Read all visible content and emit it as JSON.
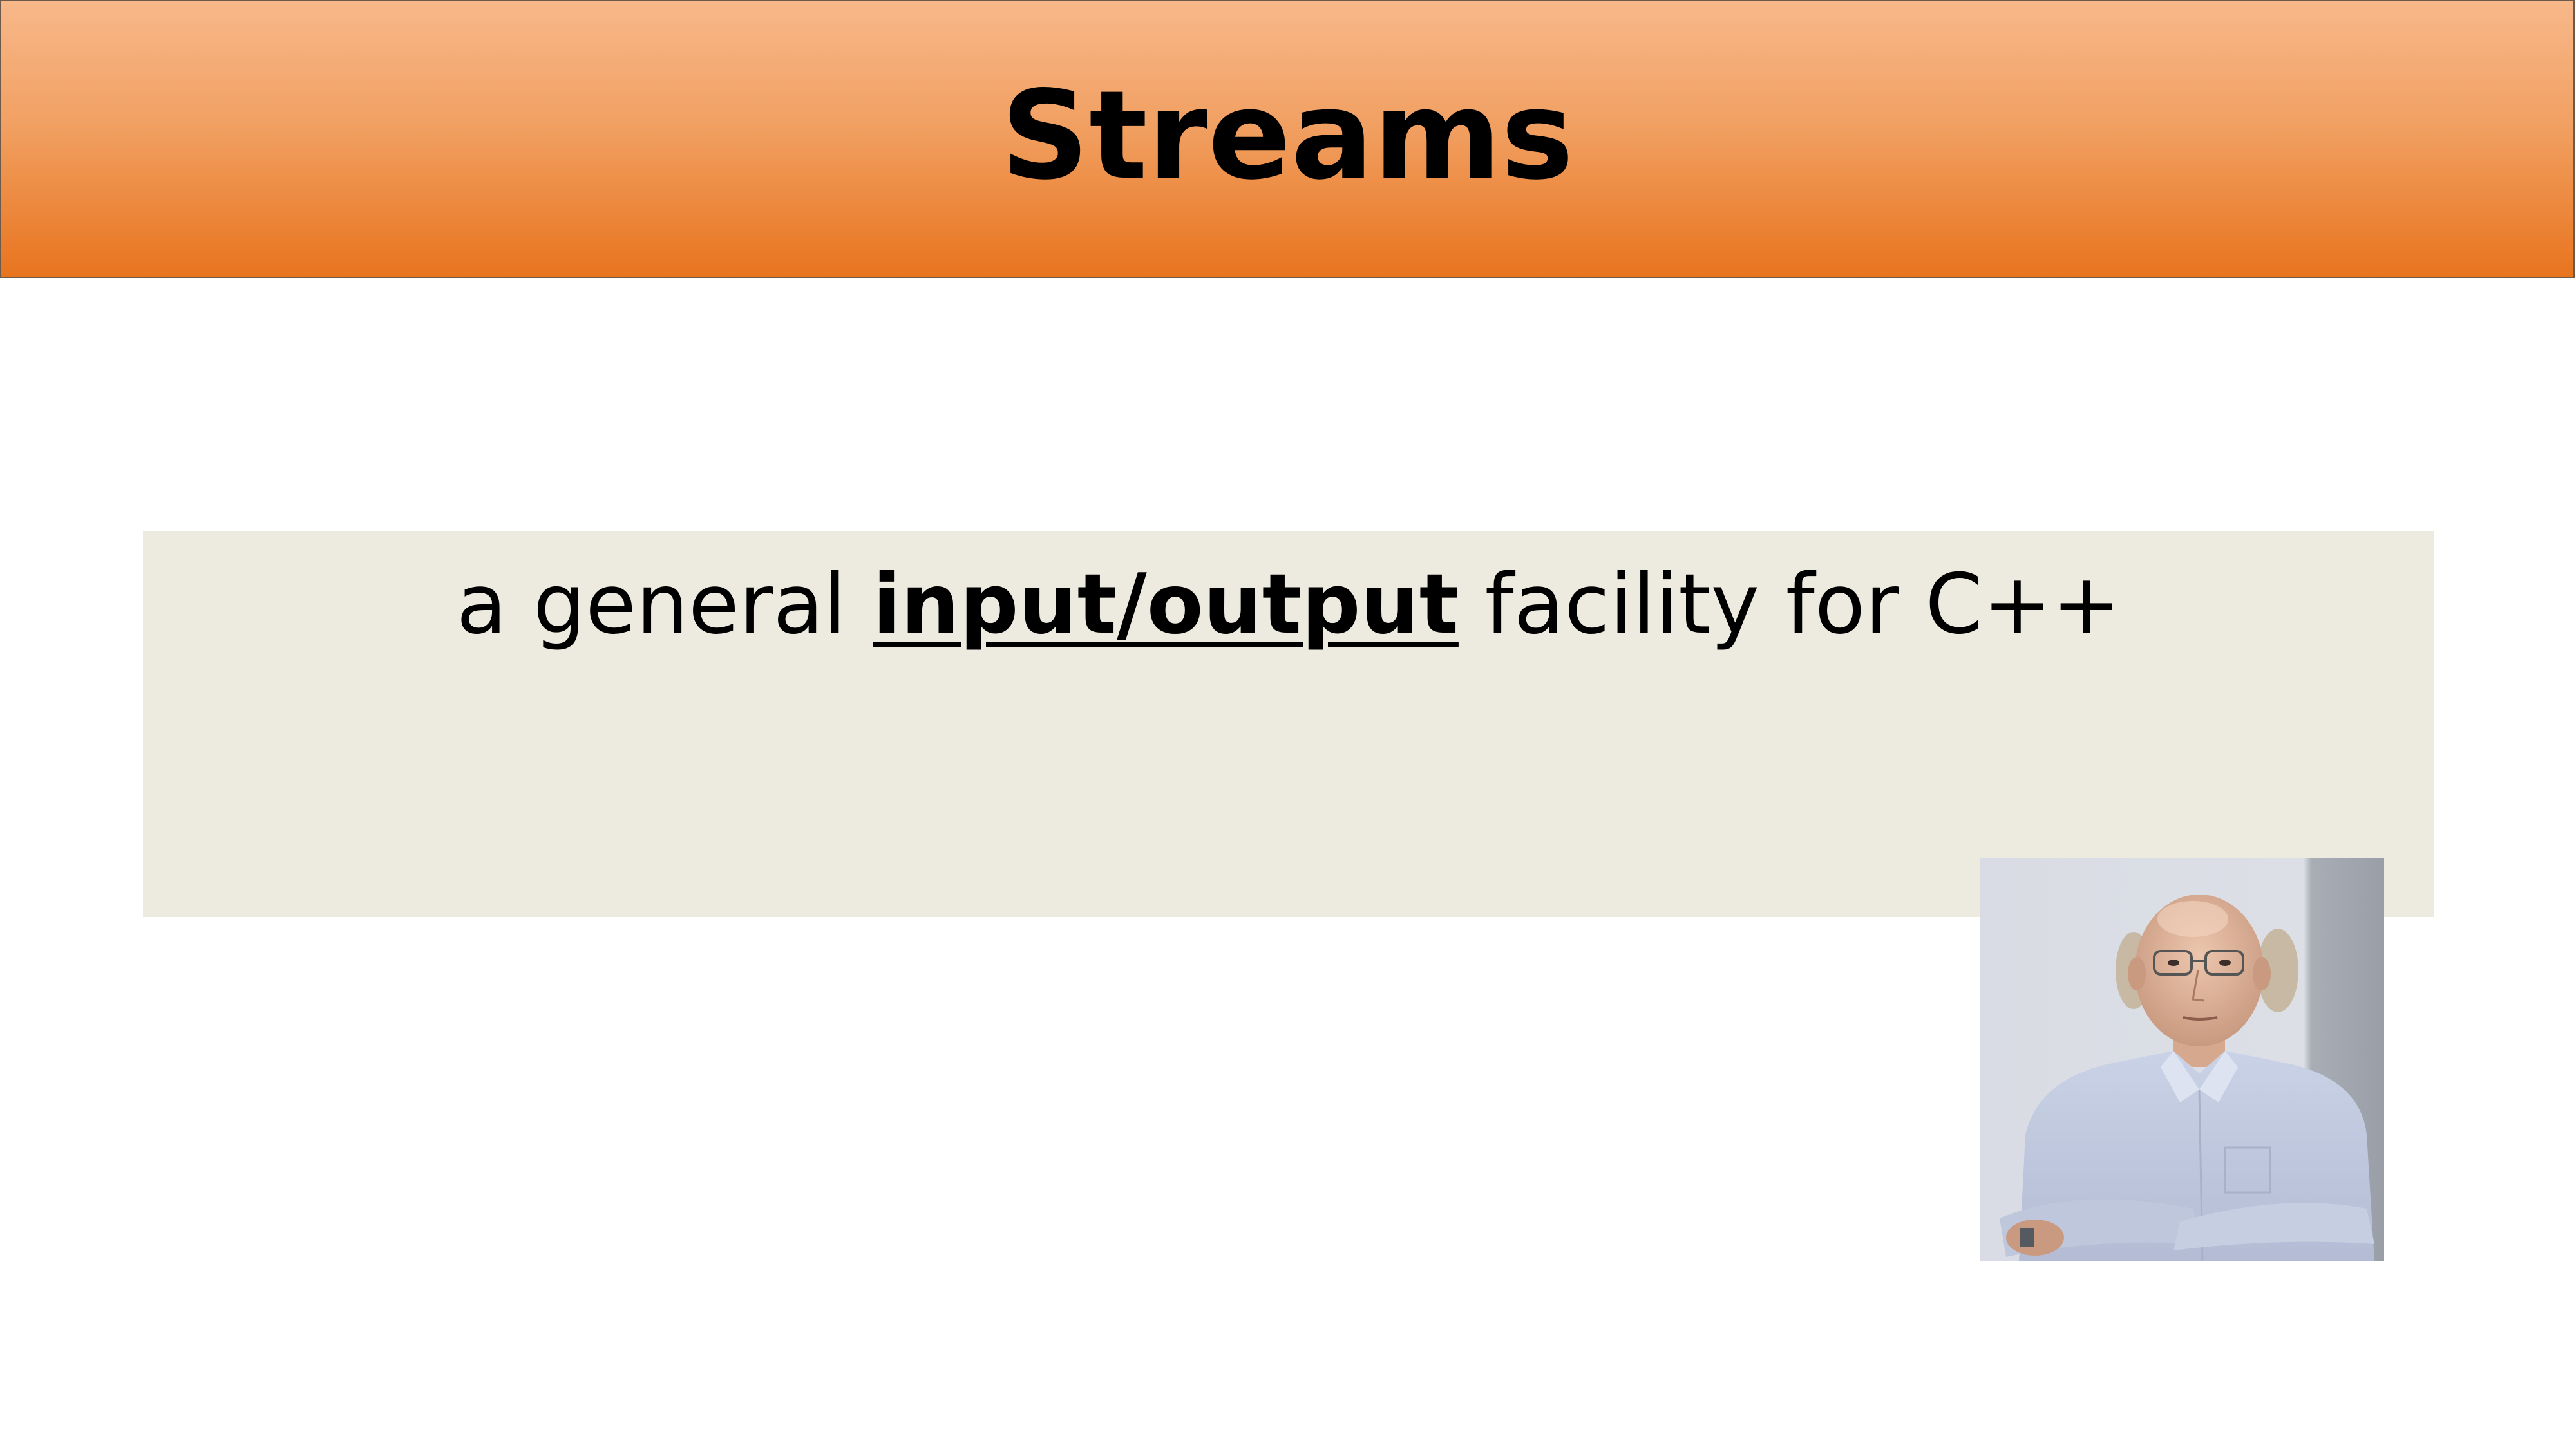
{
  "slide": {
    "title": "Streams",
    "body": {
      "prefix": "a general ",
      "emphasis": "input/output",
      "suffix": " facility for C++"
    },
    "colors": {
      "title_gradient_top": "#f8b88a",
      "title_gradient_bottom": "#e8741e",
      "content_box": "#edebe0"
    },
    "image": {
      "alt": "portrait photo"
    }
  }
}
